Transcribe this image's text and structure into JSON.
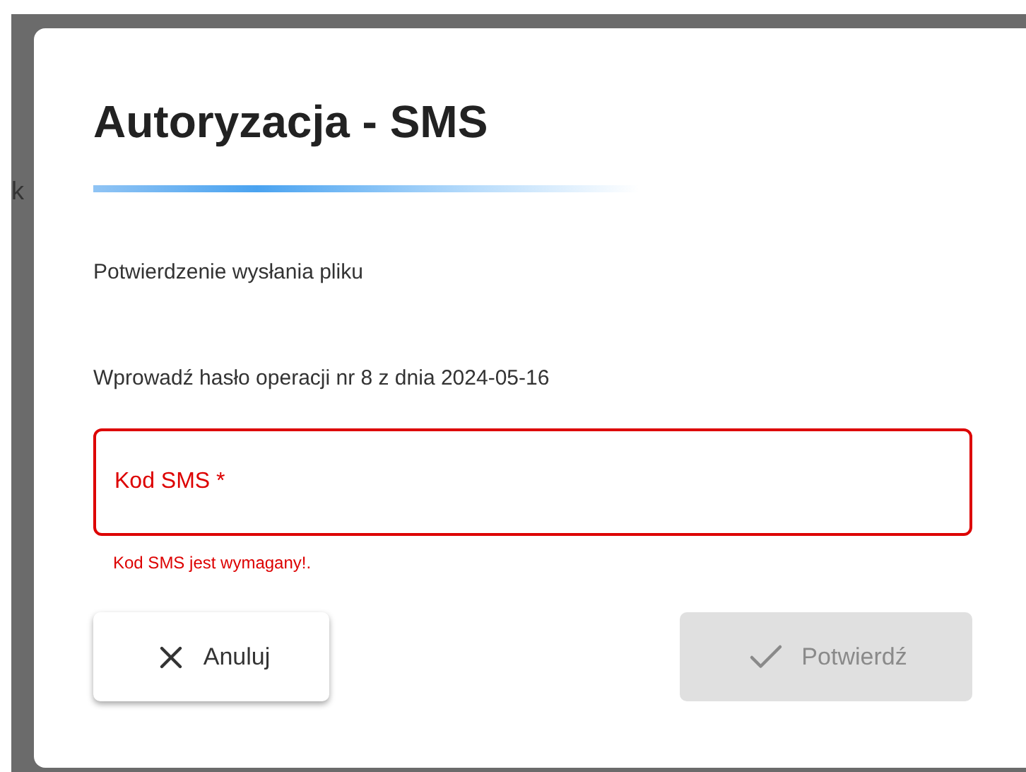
{
  "background_text": "k",
  "dialog": {
    "title": "Autoryzacja - SMS",
    "subtitle": "Potwierdzenie wysłania pliku",
    "instruction": "Wprowadź hasło operacji nr 8 z dnia 2024-05-16",
    "field": {
      "label": "Kod SMS *",
      "error": "Kod SMS jest wymagany!.",
      "invalid": true
    },
    "buttons": [
      {
        "kind": "cancel",
        "label": "Anuluj",
        "disabled": false
      },
      {
        "kind": "confirm",
        "label": "Potwierdź",
        "disabled": true
      }
    ]
  }
}
